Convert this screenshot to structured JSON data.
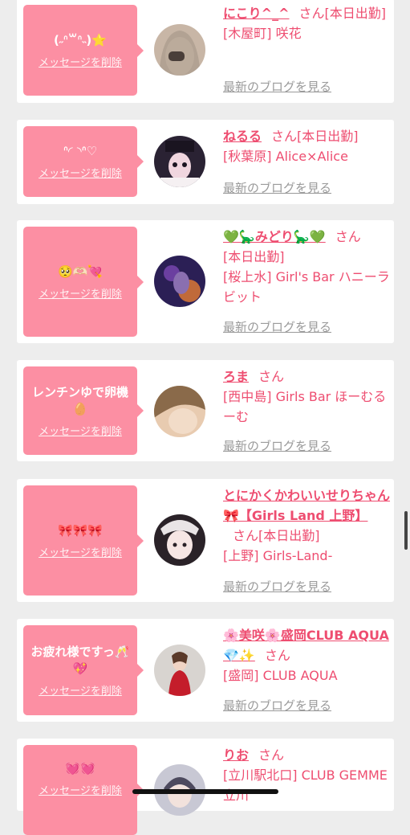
{
  "common": {
    "delete_label": "メッセージを削除",
    "blog_label": "最新のブログを見る",
    "san": "さん"
  },
  "cards": [
    {
      "message": "(˶ᐢ꒳ᐢ˵)⭐",
      "name": "にこり^_^",
      "lines": [
        "[本日出勤]",
        "[木屋町] 咲花"
      ],
      "avatar_colors": [
        "#c8b6a6",
        "#4a3f3a"
      ]
    },
    {
      "message": "ᐢ◜ ◝ᐢ♡",
      "name": "ねるる",
      "lines": [
        "[本日出勤]",
        "[秋葉原] Alice×Alice"
      ],
      "avatar_colors": [
        "#2a2233",
        "#f0d6df"
      ]
    },
    {
      "message": "🥺🫶🏻💘",
      "name": "💚🦕みどり🦕💚",
      "lines": [
        "[本日出勤]",
        "[桜上水] Girl's Bar ハニーラビット"
      ],
      "avatar_colors": [
        "#2b1f55",
        "#c06a3a"
      ]
    },
    {
      "message": "レンチンゆで卵機🥚",
      "name": "ろま",
      "lines": [
        "[西中島] Girls Bar ほーむるーむ"
      ],
      "avatar_colors": [
        "#8a6a4a",
        "#e8cbb0"
      ]
    },
    {
      "message": "🎀🎀🎀",
      "name": "とにかくかわいいせりちゃん🎀【Girls Land 上野】",
      "lines": [
        "[本日出勤]",
        "[上野] Girls-Land-"
      ],
      "avatar_colors": [
        "#e9e4e6",
        "#2a2228"
      ]
    },
    {
      "message": "お疲れ様ですっ🥂💖",
      "name": "🌸美咲🌸盛岡CLUB AQUA💎✨",
      "lines": [
        "[盛岡] CLUB AQUA"
      ],
      "avatar_colors": [
        "#d8d4d0",
        "#c41d2b"
      ]
    },
    {
      "message": "💓💓",
      "name": "りお",
      "lines": [
        "[立川駅北口] CLUB GEMME立川"
      ],
      "avatar_colors": [
        "#c8c8d4",
        "#4d4a5e"
      ]
    }
  ]
}
